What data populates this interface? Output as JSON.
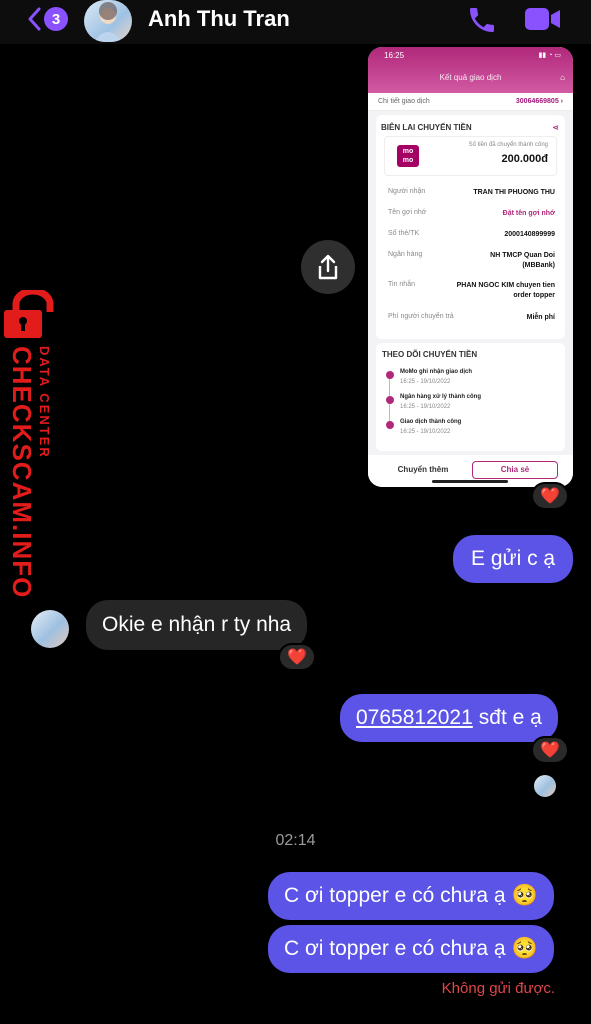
{
  "header": {
    "unread_count": "3",
    "contact_name": "Anh Thu Tran"
  },
  "watermark": {
    "brand": "CHECKSCAM.INFO",
    "sub": "DATA CENTER"
  },
  "receipt": {
    "status_time": "16:25",
    "title": "Kết quả giao dịch",
    "detail_label": "Chi tiết giao dịch",
    "detail_id": "30064669805",
    "section_title": "BIÊN LAI CHUYỂN TIỀN",
    "amount_label": "Số tiền đã chuyển thành công",
    "amount": "200.000đ",
    "logo_text": "mo mo",
    "rows": [
      {
        "k": "Người nhận",
        "v": "TRAN THI PHUONG THU"
      },
      {
        "k": "Tên gợi nhớ",
        "v": "Đặt tên gợi nhớ"
      },
      {
        "k": "Số thẻ/TK",
        "v": "2000140899999"
      },
      {
        "k": "Ngân hàng",
        "v": "NH TMCP Quan Doi (MBBank)"
      },
      {
        "k": "Tin nhắn",
        "v": "PHAN NGOC KIM chuyen tien order topper"
      },
      {
        "k": "Phí người chuyển trả",
        "v": "Miễn phí"
      }
    ],
    "track_title": "THEO DÕI CHUYỂN TIỀN",
    "timeline": [
      {
        "t": "MoMo ghi nhận giao dịch",
        "d": "16:25 - 19/10/2022"
      },
      {
        "t": "Ngân hàng xử lý thành công",
        "d": "16:25 - 19/10/2022"
      },
      {
        "t": "Giao dịch thành công",
        "d": "16:25 - 19/10/2022"
      }
    ],
    "btn_more": "Chuyển thêm",
    "btn_share": "Chia sẻ"
  },
  "messages": {
    "m1": "E gửi c ạ",
    "m2": "Okie e nhận r ty nha",
    "m3_link": "0765812021",
    "m3_text": "sđt e ạ",
    "time": "02:14",
    "m4": "C ơi topper e có chưa ạ 🥺",
    "m5": "C ơi topper e có chưa ạ 🥺",
    "fail": "Không gửi được."
  },
  "reactions": {
    "heart": "❤️"
  },
  "colors": {
    "outgoing": "#5b54e6",
    "incoming": "#262626",
    "accent": "#8a52ff",
    "error": "#e0464a"
  }
}
